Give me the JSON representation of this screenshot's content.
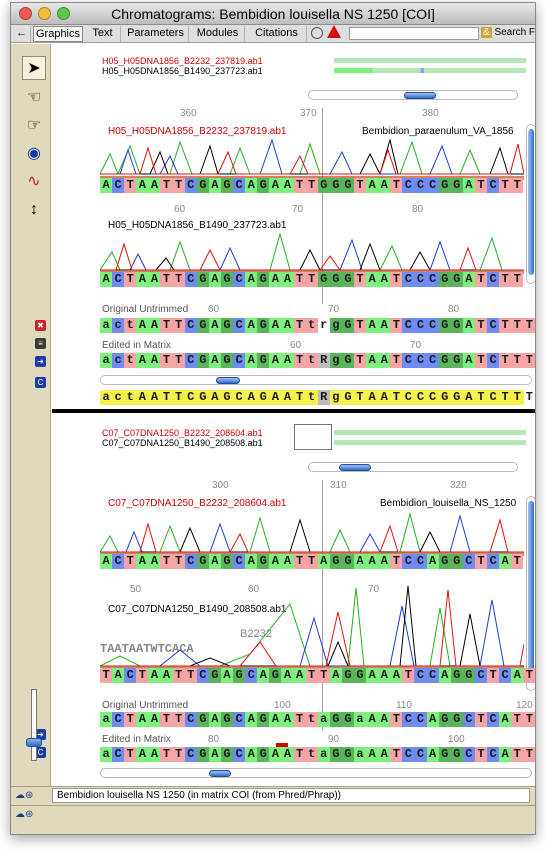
{
  "window": {
    "title": "Chromatograms: Bembidion louisella NS 1250 [COI]"
  },
  "tabs": {
    "graphics": "Graphics",
    "text": "Text",
    "parameters": "Parameters",
    "modules": "Modules",
    "citations": "Citations",
    "search_label": "Search F"
  },
  "tools": [
    "arrow-tool",
    "hand-left-tool",
    "hand-right-tool",
    "eye-tool",
    "color-wave-tool",
    "split-tool"
  ],
  "panel1": {
    "overview_names": [
      "H05_H05DNA1856_B2232_237819.ab1",
      "H05_H05DNA1856_B1490_237723.ab1"
    ],
    "ruler_top": [
      "360",
      "370",
      "380"
    ],
    "trace1_label": "H05_H05DNA1856_B2232_237819.ab1",
    "trace1_taxon": "Bembidion_paraenulum_VA_1856",
    "trace1_seq": "ACTAATTCGAGCAGAATTGGGTAATCCCGGATCTT",
    "ruler_mid": [
      "60",
      "70",
      "80"
    ],
    "trace2_label": "H05_H05DNA1856_B1490_237723.ab1",
    "trace2_seq": "ACTAATTCGAGCAGAATTGGGTAATCCCGGATCTT",
    "original_label": "Original Untrimmed",
    "original_nums": [
      "60",
      "70",
      "80"
    ],
    "original_seq": "actAATTCGAGCAGAATtrgGTAATCCCGGATCTTT",
    "edited_label": "Edited in Matrix",
    "edited_nums": [
      "60",
      "70"
    ],
    "edited_seq": "actAATTCGAGCAGAATtRgGTAATCCCGGATCTTT",
    "consensus_seq": "actAATTCGAGCAGAATtRgGTAATCCCGGATCTTT"
  },
  "panel2": {
    "overview_names": [
      "C07_C07DNA1250_B2232_208604.ab1",
      "C07_C07DNA1250_B1490_208508.ab1"
    ],
    "ruler_top": [
      "300",
      "310",
      "320"
    ],
    "trace1_label": "C07_C07DNA1250_B2232_208604.ab1",
    "trace1_taxon": "Bembidion_louisella_NS_1250",
    "trace1_seq": "ACTAATTCGAGCAGAATTAGGAAATCCAGGCTCAT",
    "ruler_mid": [
      "50",
      "60",
      "70"
    ],
    "trace2_label": "C07_C07DNA1250_B1490_208508.ab1",
    "trace2_overlay": "B2232",
    "trace2_ghost": "TAATAATWTCACA",
    "trace2_seq": "TACTAATTCGAGCAGAATTAGGAAATCCAGGCTCAT",
    "original_label": "Original Untrimmed",
    "original_nums": [
      "100",
      "110",
      "120"
    ],
    "original_seq": "aCTAATTCGAGCAGAATtaGGaAATCCAGGCTCATT",
    "edited_label": "Edited in Matrix",
    "edited_nums": [
      "80",
      "90",
      "100"
    ],
    "edited_seq": "aCTAATTCGAGCAGAATtaGGaAATCCAGGCTCATT"
  },
  "status": {
    "text": "Bembidion louisella NS 1250 (in matrix COI (from Phred/Phrap))"
  },
  "colors": {
    "A": "#7df07d",
    "C": "#6f8cf2",
    "G": "#5ab55a",
    "T": "#f5a5a5",
    "trace_a": "#22b022",
    "trace_c": "#1e3cd8",
    "trace_g": "#000000",
    "trace_t": "#e01010"
  }
}
